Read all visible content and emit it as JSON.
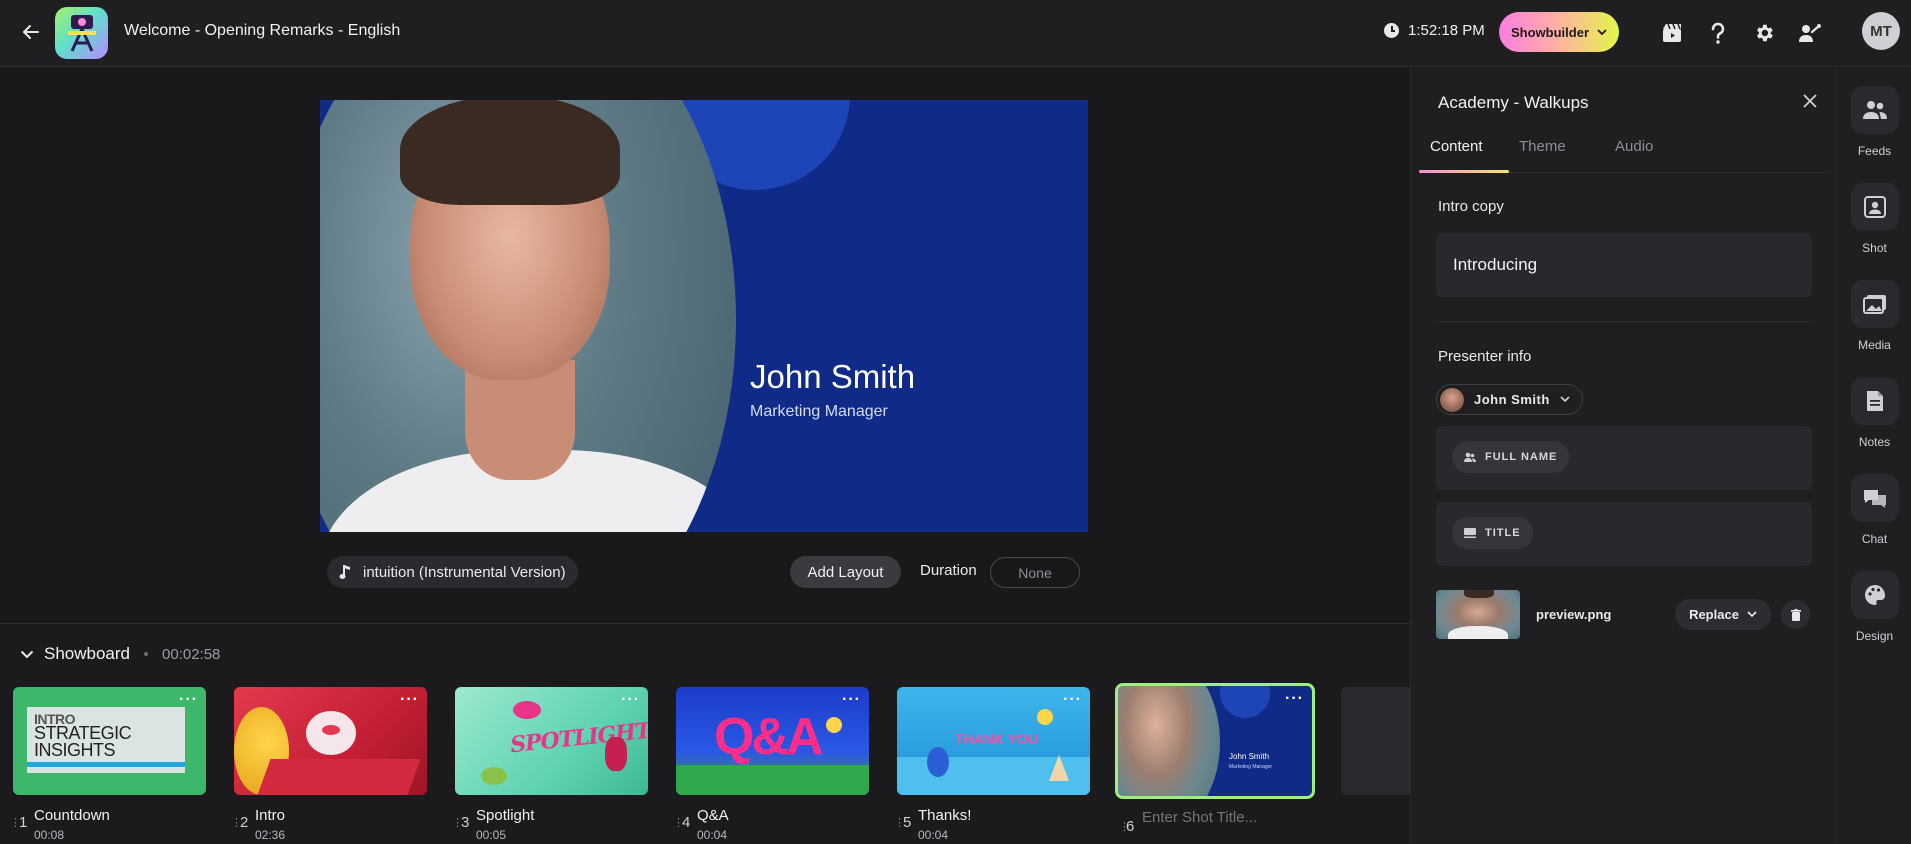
{
  "header": {
    "title": "Welcome  - Opening Remarks - English",
    "clock": "1:52:18 PM",
    "showbuilder_label": "Showbuilder",
    "user_initials": "MT"
  },
  "preview": {
    "presenter_name": "John Smith",
    "presenter_title": "Marketing Manager"
  },
  "controls": {
    "music_track": "intuition (Instrumental Version)",
    "add_layout": "Add Layout",
    "duration_label": "Duration",
    "duration_value": "None"
  },
  "showboard": {
    "title": "Showboard",
    "total_time": "00:02:58",
    "shots": [
      {
        "num": "1",
        "name": "Countdown",
        "duration": "00:08"
      },
      {
        "num": "2",
        "name": "Intro",
        "duration": "02:36"
      },
      {
        "num": "3",
        "name": "Spotlight",
        "duration": "00:05"
      },
      {
        "num": "4",
        "name": "Q&A",
        "duration": "00:04"
      },
      {
        "num": "5",
        "name": "Thanks!",
        "duration": "00:04"
      },
      {
        "num": "6",
        "name": "",
        "duration": ""
      }
    ],
    "new_shot_placeholder": "Enter Shot Title...",
    "thumb_text": {
      "countdown_line1": "INTRO",
      "countdown_line2": "STRATEGIC",
      "countdown_line3": "INSIGHTS",
      "spotlight": "SPOTLIGHT",
      "qa": "Q&A",
      "thanks": "THANK YOU",
      "shot6_name": "John Smith",
      "shot6_title": "Marketing Manager"
    }
  },
  "panel": {
    "title": "Academy - Walkups",
    "tabs": [
      "Content",
      "Theme",
      "Audio"
    ],
    "intro_copy_label": "Intro copy",
    "intro_copy_value": "Introducing",
    "presenter_info_label": "Presenter info",
    "presenter_select": "John Smith",
    "full_name_chip": "FULL NAME",
    "title_chip": "TITLE",
    "file_name": "preview.png",
    "replace_label": "Replace"
  },
  "rail": {
    "items": [
      "Feeds",
      "Shot",
      "Media",
      "Notes",
      "Chat",
      "Design"
    ]
  },
  "colors": {
    "accent_gradient_start": "#ff7de0",
    "accent_gradient_end": "#e3f54a",
    "preview_blue": "#0f2a87",
    "active_shot_border": "#9ef07a"
  }
}
